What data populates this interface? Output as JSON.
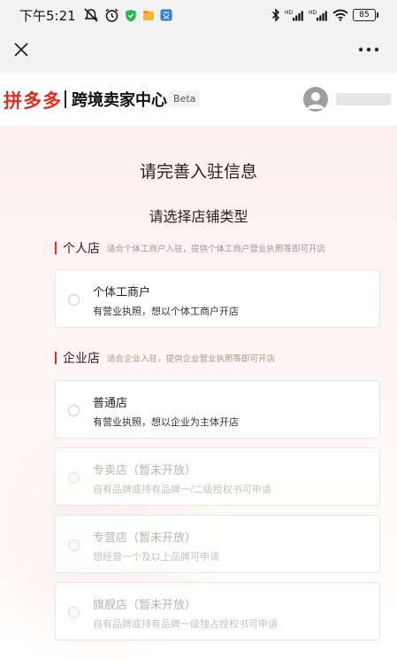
{
  "status_bar": {
    "time": "下午5:21",
    "battery": "85",
    "signal1_label": "HD",
    "signal2_label": "HD"
  },
  "nav": {
    "close_icon": "close-icon",
    "more_icon": "more-icon"
  },
  "header": {
    "logo": "拼多多",
    "title": "跨境卖家中心",
    "badge": "Beta"
  },
  "main": {
    "title": "请完善入驻信息",
    "subtitle": "请选择店铺类型",
    "sections": [
      {
        "title": "个人店",
        "desc": "适合个体工商户入驻，提供个体工商户营业执照等即可开店",
        "options": [
          {
            "title": "个体工商户",
            "desc": "有营业执照，想以个体工商户开店",
            "disabled": false
          }
        ]
      },
      {
        "title": "企业店",
        "desc": "适合企业入驻，提供企业营业执照等即可开店",
        "options": [
          {
            "title": "普通店",
            "desc": "有营业执照，想以企业为主体开店",
            "disabled": false
          },
          {
            "title": "专卖店（暂未开放）",
            "desc": "自有品牌或持有品牌一/二级授权书可申请",
            "disabled": true
          },
          {
            "title": "专营店（暂未开放）",
            "desc": "想经营一个及以上品牌可申请",
            "disabled": true
          },
          {
            "title": "旗舰店（暂未开放）",
            "desc": "自有品牌或持有品牌一级独占授权书可申请",
            "disabled": true
          }
        ]
      }
    ]
  },
  "colors": {
    "brand_red": "#e02e24",
    "card_border": "#e6e6e6"
  }
}
